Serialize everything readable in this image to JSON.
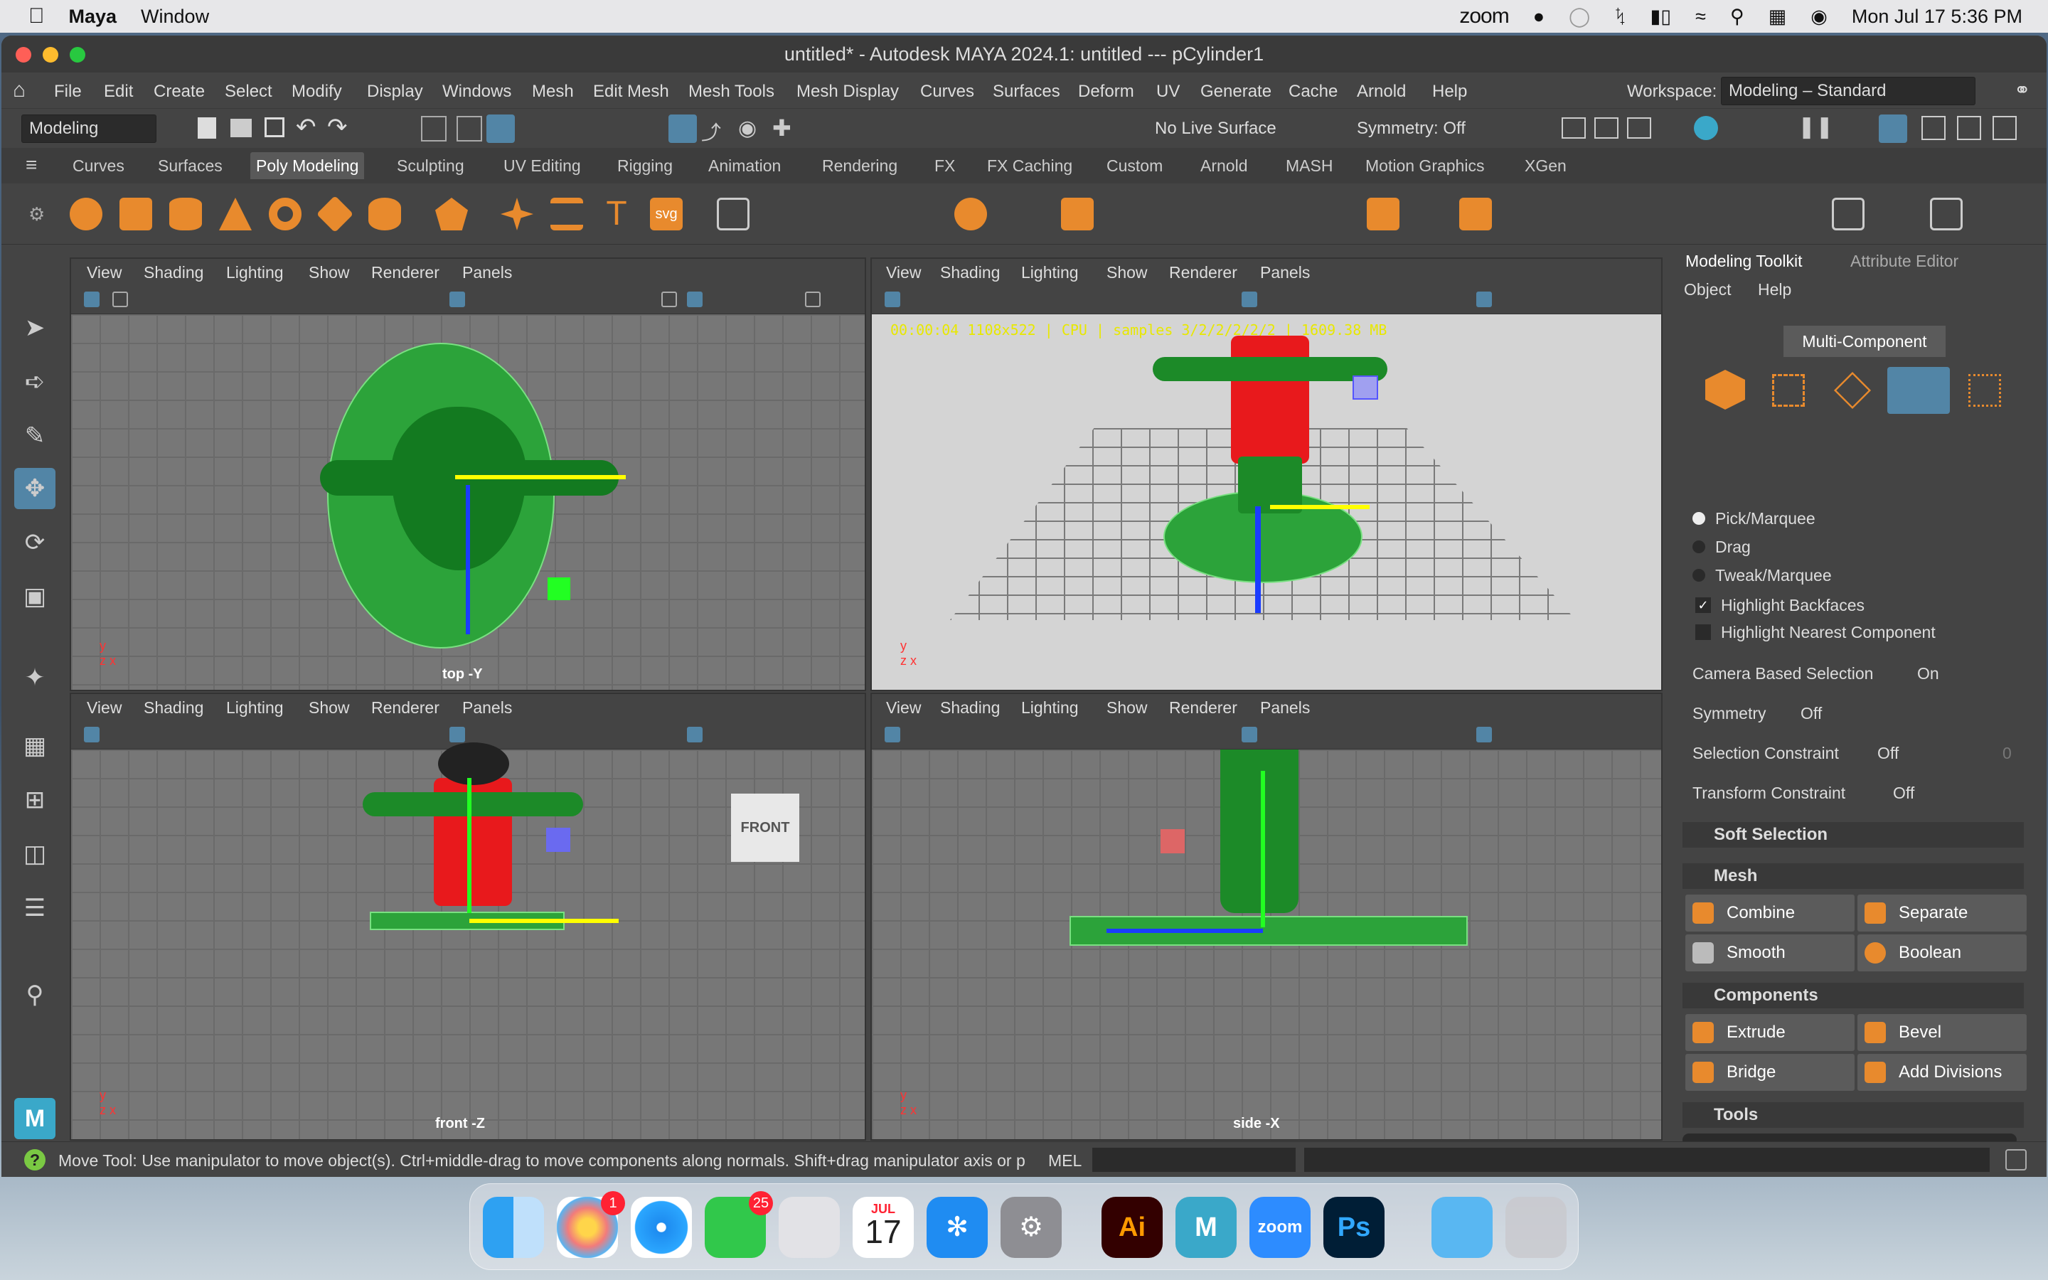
{
  "mac_menubar": {
    "app": "Maya",
    "window": "Window",
    "zoom": "zoom",
    "datetime": "Mon Jul 17  5:36 PM"
  },
  "window_title": "untitled* - Autodesk MAYA 2024.1: untitled   ---   pCylinder1",
  "main_menu": [
    "File",
    "Edit",
    "Create",
    "Select",
    "Modify",
    "Display",
    "Windows",
    "Mesh",
    "Edit Mesh",
    "Mesh Tools",
    "Mesh Display",
    "Curves",
    "Surfaces",
    "Deform",
    "UV",
    "Generate",
    "Cache",
    "Arnold",
    "Help"
  ],
  "workspace": {
    "label": "Workspace:",
    "value": "Modeling – Standard"
  },
  "status": {
    "mode": "Modeling",
    "live_surface": "No Live Surface",
    "symmetry": "Symmetry: Off"
  },
  "shelf_tabs": [
    "Curves",
    "Surfaces",
    "Poly Modeling",
    "Sculpting",
    "UV Editing",
    "Rigging",
    "Animation",
    "Rendering",
    "FX",
    "FX Caching",
    "Custom",
    "Arnold",
    "MASH",
    "Motion Graphics",
    "XGen"
  ],
  "shelf_active": "Poly Modeling",
  "viewport_menu": [
    "View",
    "Shading",
    "Lighting",
    "Show",
    "Renderer",
    "Panels"
  ],
  "viewports": {
    "top": "top -Y",
    "persp_stats": "00:00:04 1108x522 | CPU | samples 3/2/2/2/2/2 | 1609.38 MB",
    "front": "front -Z",
    "side": "side -X",
    "cube": "FRONT"
  },
  "panel": {
    "tabs": [
      "Modeling Toolkit",
      "Attribute Editor"
    ],
    "menu": [
      "Object",
      "Help"
    ],
    "multi": "Multi-Component",
    "radios": [
      "Pick/Marquee",
      "Drag",
      "Tweak/Marquee"
    ],
    "checks": [
      "Highlight Backfaces",
      "Highlight Nearest Component"
    ],
    "rows": [
      {
        "label": "Camera Based Selection",
        "value": "On"
      },
      {
        "label": "Symmetry",
        "value": "Off"
      },
      {
        "label": "Selection Constraint",
        "value": "Off",
        "extra": "0"
      },
      {
        "label": "Transform Constraint",
        "value": "Off"
      }
    ],
    "soft": "Soft Selection",
    "mesh": "Mesh",
    "mesh_btns": [
      "Combine",
      "Separate",
      "Smooth",
      "Boolean"
    ],
    "components": "Components",
    "comp_btns": [
      "Extrude",
      "Bevel",
      "Bridge",
      "Add Divisions"
    ],
    "tools": "Tools"
  },
  "helpline": {
    "text": "Move Tool: Use manipulator to move object(s). Ctrl+middle-drag to move components along normals. Shift+drag manipulator axis or plane",
    "mel": "MEL"
  },
  "dock": {
    "photos_badge": "1",
    "messages_badge": "25",
    "calendar_month": "JUL",
    "calendar_day": "17",
    "ai": "Ai",
    "ps": "Ps",
    "zoom": "zoom",
    "maya": "M"
  },
  "colors": {
    "accent": "#5285a6",
    "maya_orange": "#e88a2d",
    "character_red": "#e8191c",
    "character_green": "#1f8a2c"
  }
}
